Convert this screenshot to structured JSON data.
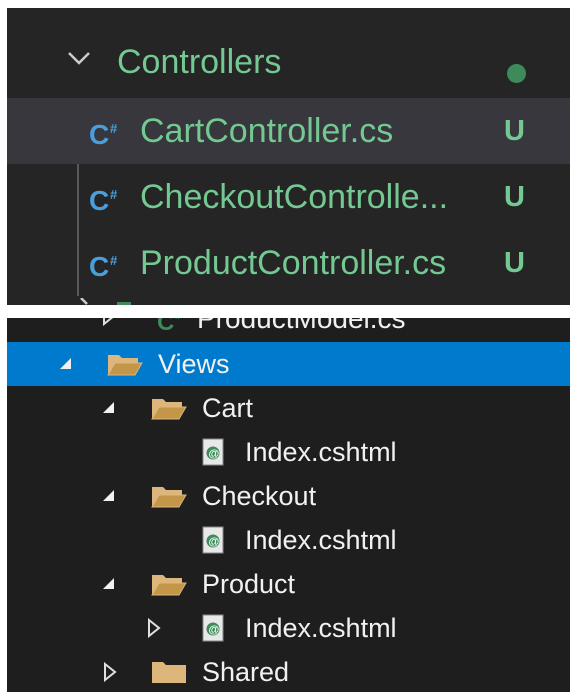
{
  "vscode_explorer": {
    "folder": {
      "name": "Controllers",
      "expanded": true,
      "modified_indicator": "dot"
    },
    "files": [
      {
        "name": "CartController.cs",
        "status": "U",
        "icon": "csharp-icon",
        "selected": true
      },
      {
        "name": "CheckoutControlle...",
        "status": "U",
        "icon": "csharp-icon",
        "selected": false
      },
      {
        "name": "ProductController.cs",
        "status": "U",
        "icon": "csharp-icon",
        "selected": false
      }
    ],
    "colors": {
      "background": "#252526",
      "selected_row": "#37373d",
      "untracked_text": "#73c991",
      "csharp_icon": "#4a9fdb"
    }
  },
  "solution_explorer": {
    "partial_row": {
      "name": "ProductModel.cs",
      "icon": "csharp-icon"
    },
    "nodes": [
      {
        "name": "Views",
        "type": "folder",
        "expanded": true,
        "selected": true,
        "icon": "open-folder-icon"
      },
      {
        "name": "Cart",
        "type": "folder",
        "expanded": true,
        "icon": "open-folder-icon"
      },
      {
        "name": "Index.cshtml",
        "type": "file",
        "icon": "razor-file-icon"
      },
      {
        "name": "Checkout",
        "type": "folder",
        "expanded": true,
        "icon": "open-folder-icon"
      },
      {
        "name": "Index.cshtml",
        "type": "file",
        "icon": "razor-file-icon"
      },
      {
        "name": "Product",
        "type": "folder",
        "expanded": true,
        "icon": "open-folder-icon"
      },
      {
        "name": "Index.cshtml",
        "type": "file",
        "expanded": false,
        "icon": "razor-file-icon"
      },
      {
        "name": "Shared",
        "type": "folder",
        "expanded": false,
        "icon": "closed-folder-icon"
      }
    ],
    "colors": {
      "background": "#1e1e1e",
      "selected_row": "#007acc",
      "text": "#f1f1f1",
      "folder": "#dcb67a"
    }
  }
}
